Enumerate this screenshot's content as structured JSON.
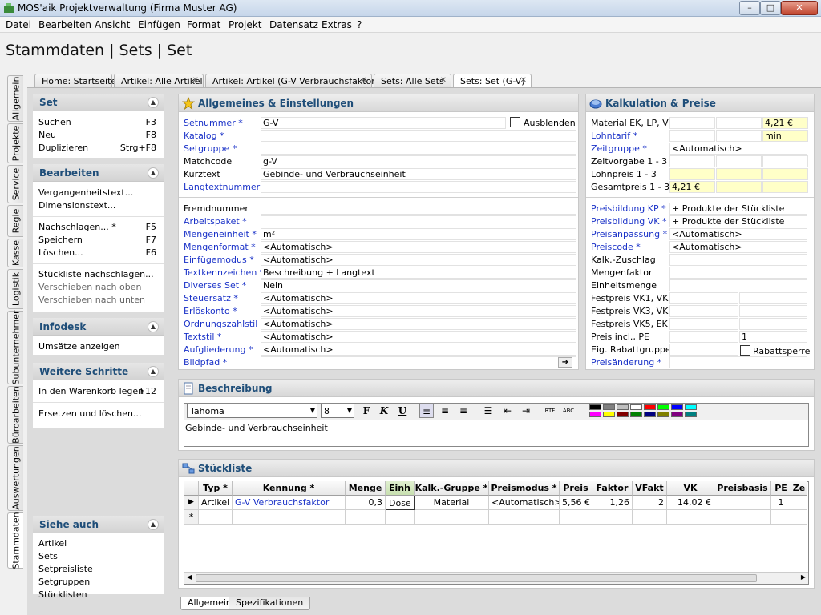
{
  "window": {
    "title": "MOS'aik Projektverwaltung (Firma Muster AG)",
    "minimize": "–",
    "maximize": "□",
    "close": "✕"
  },
  "menu": [
    "Datei",
    "Bearbeiten",
    "Ansicht",
    "Einfügen",
    "Format",
    "Projekt",
    "Datensatz",
    "Extras",
    "?"
  ],
  "page_title": "Stammdaten | Sets | Set",
  "doc_tabs": [
    "Home: Startseite",
    "Artikel: Alle Artikel",
    "Artikel: Artikel (G-V Verbrauchsfaktor)",
    "Sets: Alle Sets",
    "Sets: Set (G-V)"
  ],
  "vertical_tabs": [
    "Allgemein",
    "Projekte",
    "Service",
    "Regie",
    "Kasse",
    "Logistik",
    "Subunternehmer",
    "Büroarbeiten",
    "Auswertungen",
    "Stammdaten"
  ],
  "panel_set": {
    "title": "Set",
    "items": [
      {
        "label": "Suchen",
        "key": "F3"
      },
      {
        "label": "Neu",
        "key": "F8"
      },
      {
        "label": "Duplizieren",
        "key": "Strg+F8"
      }
    ]
  },
  "panel_bearbeiten": {
    "title": "Bearbeiten",
    "items": [
      {
        "label": "Vergangenheitstext..."
      },
      {
        "label": "Dimensionstext..."
      },
      {
        "label": "Nachschlagen... *",
        "key": "F5"
      },
      {
        "label": "Speichern",
        "key": "F7"
      },
      {
        "label": "Löschen...",
        "key": "F6"
      },
      {
        "label": "Stückliste nachschlagen..."
      },
      {
        "label": "Verschieben nach oben"
      },
      {
        "label": "Verschieben nach unten"
      }
    ]
  },
  "panel_infodesk": {
    "title": "Infodesk",
    "items": [
      {
        "label": "Umsätze anzeigen"
      }
    ]
  },
  "panel_weitere": {
    "title": "Weitere Schritte",
    "items": [
      {
        "label": "In den Warenkorb legen",
        "key": "F12"
      },
      {
        "label": "Ersetzen und löschen..."
      }
    ]
  },
  "panel_siehe": {
    "title": "Siehe auch",
    "items": [
      "Artikel",
      "Sets",
      "Setpreisliste",
      "Setgruppen",
      "Stücklisten"
    ]
  },
  "allgemeines": {
    "title": "Allgemeines & Einstellungen",
    "ausblenden": "Ausblenden",
    "fields_top": [
      {
        "label": "Setnummer *",
        "value": "G-V",
        "link": true
      },
      {
        "label": "Katalog *",
        "value": "",
        "link": true
      },
      {
        "label": "Setgruppe *",
        "value": "",
        "link": true
      },
      {
        "label": "Matchcode",
        "value": "g-V",
        "link": false
      },
      {
        "label": "Kurztext",
        "value": "Gebinde- und Verbrauchseinheit",
        "link": false
      },
      {
        "label": "Langtextnummer *",
        "value": "",
        "link": true
      }
    ],
    "fields_bottom": [
      {
        "label": "Fremdnummer",
        "value": "",
        "link": false
      },
      {
        "label": "Arbeitspaket *",
        "value": "",
        "link": true
      },
      {
        "label": "Mengeneinheit *",
        "value": "m²",
        "link": true
      },
      {
        "label": "Mengenformat *",
        "value": "<Automatisch>",
        "link": true
      },
      {
        "label": "Einfügemodus *",
        "value": "<Automatisch>",
        "link": true
      },
      {
        "label": "Textkennzeichen *",
        "value": "Beschreibung + Langtext",
        "link": true
      },
      {
        "label": "Diverses Set *",
        "value": "Nein",
        "link": true
      },
      {
        "label": "Steuersatz *",
        "value": "<Automatisch>",
        "link": true
      },
      {
        "label": "Erlöskonto *",
        "value": "<Automatisch>",
        "link": true
      },
      {
        "label": "Ordnungszahlstil *",
        "value": "<Automatisch>",
        "link": true
      },
      {
        "label": "Textstil *",
        "value": "<Automatisch>",
        "link": true
      },
      {
        "label": "Aufgliederung *",
        "value": "<Automatisch>",
        "link": true
      },
      {
        "label": "Bildpfad *",
        "value": "",
        "link": true
      }
    ]
  },
  "kalkulation": {
    "title": "Kalkulation & Preise",
    "rows_top": [
      {
        "label": "Material EK, LP, VK",
        "v1": "",
        "v2": "",
        "v3": "4,21 €",
        "link": false
      },
      {
        "label": "Lohntarif *",
        "v1": "",
        "v2": "",
        "v3": "min",
        "link": true
      },
      {
        "label": "Zeitgruppe *",
        "v1": "<Automatisch>",
        "link": true
      },
      {
        "label": "Zeitvorgabe 1 - 3",
        "v1": "",
        "v2": "",
        "v3": "",
        "link": false
      },
      {
        "label": "Lohnpreis 1 - 3",
        "v1": "",
        "v2": "",
        "v3": "",
        "link": false
      },
      {
        "label": "Gesamtpreis 1 - 3",
        "v1": "4,21 €",
        "v2": "",
        "v3": "",
        "link": false
      }
    ],
    "rows_bottom": [
      {
        "label": "Preisbildung KP *",
        "value": "+ Produkte der Stückliste",
        "link": true
      },
      {
        "label": "Preisbildung VK *",
        "value": "+ Produkte der Stückliste",
        "link": true
      },
      {
        "label": "Preisanpassung *",
        "value": "<Automatisch>",
        "link": true
      },
      {
        "label": "Preiscode *",
        "value": "<Automatisch>",
        "link": true
      },
      {
        "label": "Kalk.-Zuschlag",
        "value": "",
        "link": false
      },
      {
        "label": "Mengenfaktor",
        "value": "",
        "link": false
      },
      {
        "label": "Einheitsmenge",
        "value": "",
        "link": false
      },
      {
        "label": "Festpreis VK1, VK2",
        "value": "",
        "link": false
      },
      {
        "label": "Festpreis VK3, VK4",
        "value": "",
        "link": false
      },
      {
        "label": "Festpreis VK5, EK",
        "value": "",
        "link": false
      },
      {
        "label": "Preis incl., PE",
        "value": "1",
        "link": false
      },
      {
        "label": "Eig. Rabattgruppe",
        "value": "",
        "link": false
      },
      {
        "label": "Preisänderung *",
        "value": "",
        "link": true
      }
    ],
    "rabattsperre": "Rabattsperre"
  },
  "beschreibung": {
    "title": "Beschreibung",
    "font": "Tahoma",
    "size": "8",
    "bold": "F",
    "italic": "K",
    "underline": "U",
    "text": "Gebinde- und Verbrauchseinheit",
    "colors": [
      "#000000",
      "#808080",
      "#c0c0c0",
      "#ffffff",
      "#ff0000",
      "#00ff00",
      "#0000ff",
      "#00ffff",
      "#ff00ff",
      "#ffff00",
      "#800000",
      "#008000",
      "#000080",
      "#808000",
      "#800080",
      "#008080"
    ]
  },
  "stueckliste": {
    "title": "Stückliste",
    "columns": [
      "Typ *",
      "Kennung *",
      "Menge",
      "Einh",
      "Kalk.-Gruppe *",
      "Preismodus *",
      "Preis",
      "Faktor",
      "VFakt",
      "VK",
      "Preisbasis",
      "PE",
      "Ze"
    ],
    "row": [
      "Artikel",
      "G-V Verbrauchsfaktor",
      "0,3",
      "Dose",
      "Material",
      "<Automatisch>",
      "5,56 €",
      "1,26",
      "2",
      "14,02 €",
      "",
      "1",
      ""
    ],
    "new_row_marker": "*"
  },
  "bottom_tabs": [
    "Allgemein",
    "Spezifikationen"
  ]
}
